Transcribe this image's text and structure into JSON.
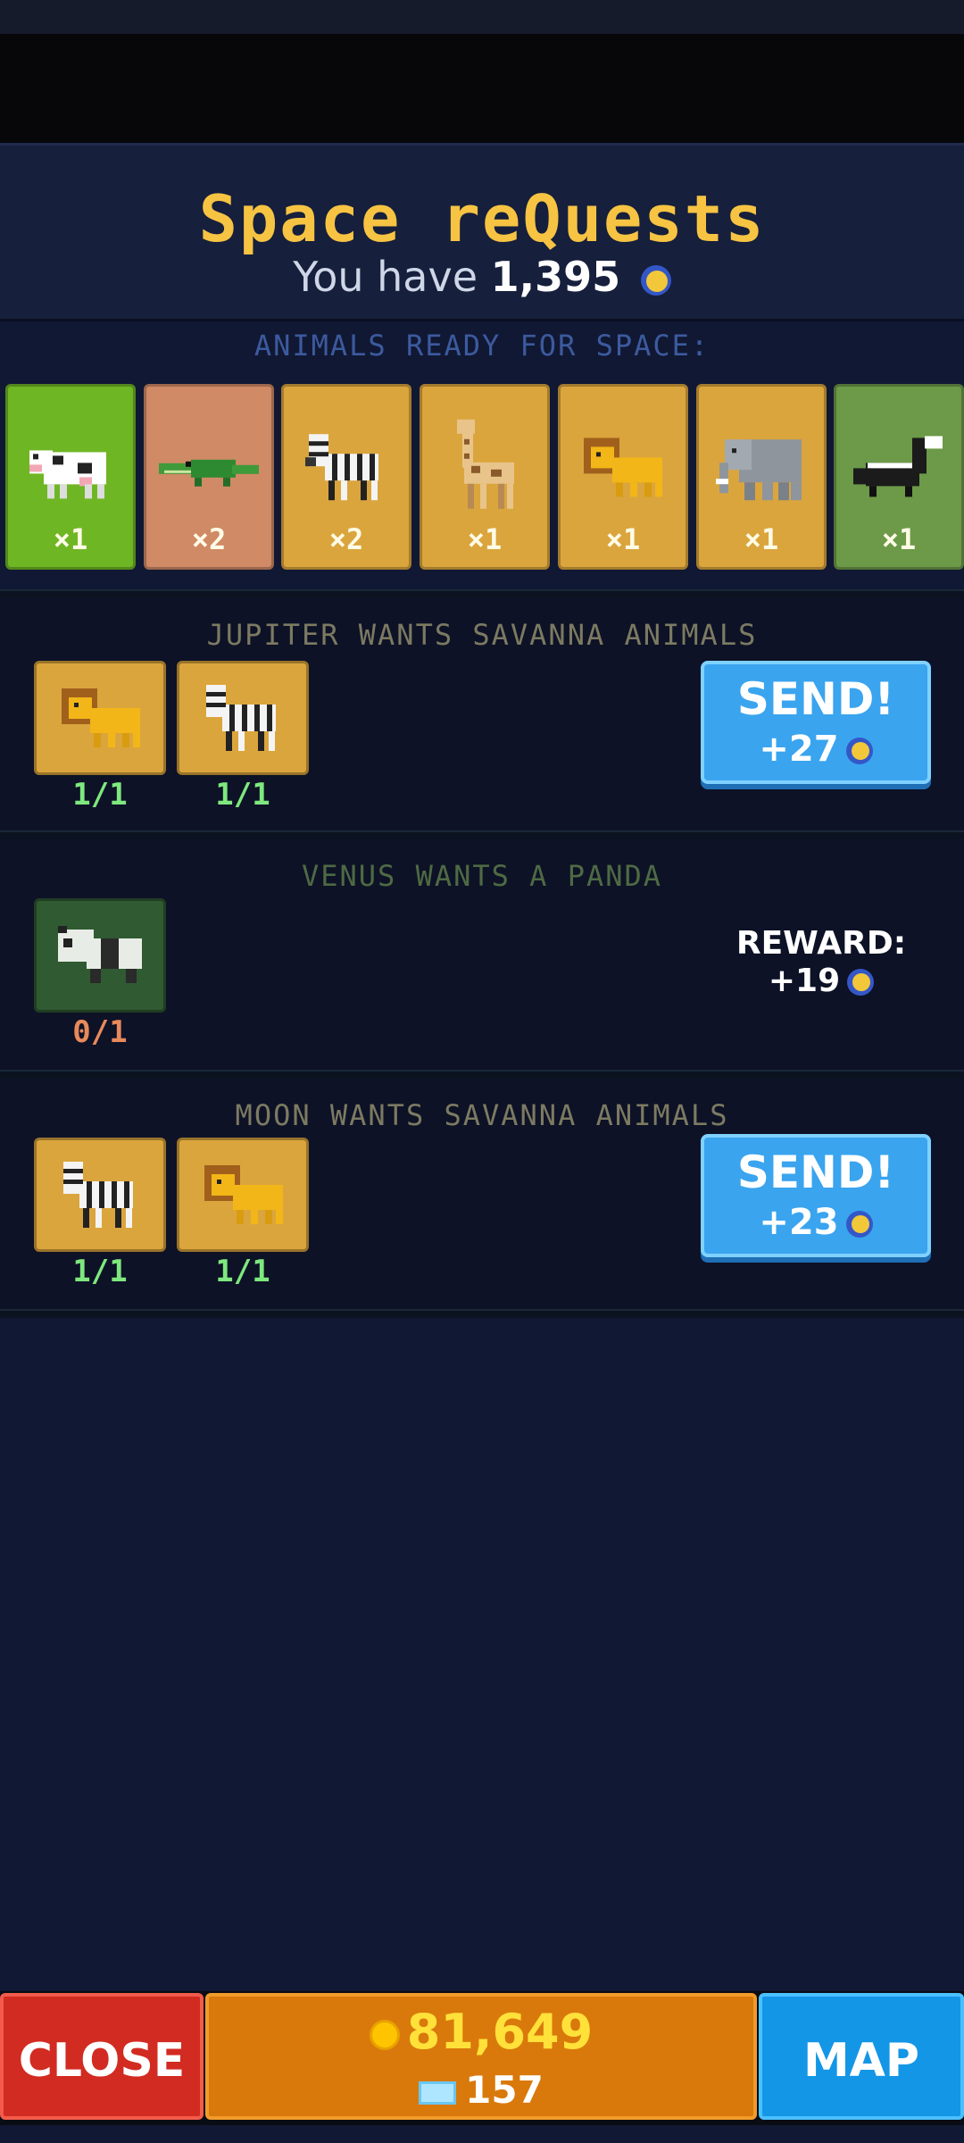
{
  "header": {
    "title": "Space reQuests",
    "balance_prefix": "You have",
    "balance_value": "1,395",
    "balance_icon": "moon-token-icon"
  },
  "ready": {
    "label": "ANIMALS READY FOR SPACE:",
    "animals": [
      {
        "name": "cow",
        "count": "×1",
        "bg": "#6fb624"
      },
      {
        "name": "crocodile",
        "count": "×2",
        "bg": "#d08a66"
      },
      {
        "name": "zebra",
        "count": "×2",
        "bg": "#dba53d"
      },
      {
        "name": "giraffe",
        "count": "×1",
        "bg": "#dba53d"
      },
      {
        "name": "lion",
        "count": "×1",
        "bg": "#dba53d"
      },
      {
        "name": "elephant",
        "count": "×1",
        "bg": "#dba53d"
      },
      {
        "name": "skunk",
        "count": "×1",
        "bg": "#6c9a48"
      }
    ]
  },
  "requests": [
    {
      "title": "JUPITER WANTS SAVANNA ANIMALS",
      "title_color": "#7c7a62",
      "items": [
        {
          "animal": "lion",
          "progress": "1/1",
          "progress_color": "#7ee87e"
        },
        {
          "animal": "zebra",
          "progress": "1/1",
          "progress_color": "#7ee87e"
        }
      ],
      "action": "SEND!",
      "reward": "+27"
    },
    {
      "title": "VENUS WANTS A PANDA",
      "title_color": "#4e6a44",
      "items": [
        {
          "animal": "panda",
          "progress": "0/1",
          "progress_color": "#e8895a"
        }
      ],
      "reward_label": "REWARD:",
      "reward": "+19"
    },
    {
      "title": "MOON WANTS SAVANNA ANIMALS",
      "title_color": "#7c7a62",
      "items": [
        {
          "animal": "zebra",
          "progress": "1/1",
          "progress_color": "#7ee87e"
        },
        {
          "animal": "lion",
          "progress": "1/1",
          "progress_color": "#7ee87e"
        }
      ],
      "action": "SEND!",
      "reward": "+23"
    }
  ],
  "footer": {
    "close": "CLOSE",
    "coins": "81,649",
    "gems": "157",
    "map": "MAP"
  },
  "colors": {
    "accent_title": "#f6c343",
    "savanna_card": "#dba53d",
    "bamboo_card": "#2f5a32",
    "send_button": "#3aa4ef",
    "close_button": "#d22b22",
    "map_button": "#1496e6",
    "currency_panel": "#d9790b"
  }
}
